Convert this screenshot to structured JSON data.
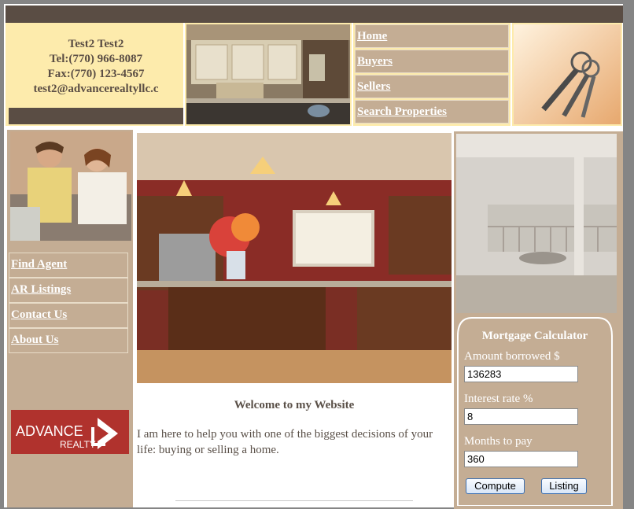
{
  "contact": {
    "name": "Test2  Test2",
    "tel": "Tel:(770) 966-8087",
    "fax": "Fax:(770) 123-4567",
    "email": "test2@advancerealtyllc.c"
  },
  "top_nav": [
    "Home",
    "Buyers",
    "Sellers",
    "Search Properties"
  ],
  "side_nav": [
    "Find Agent",
    "AR Listings",
    "Contact Us",
    "About Us"
  ],
  "logo": {
    "text_main": "ADVANCE",
    "text_sub": "REALTY"
  },
  "main": {
    "welcome": "Welcome to my Website",
    "intro": "I am here to help you with one of the biggest decisions of your life: buying or selling a home."
  },
  "calculator": {
    "title": "Mortgage Calculator",
    "amount_label": "Amount borrowed $",
    "amount_value": "136283",
    "rate_label": "Interest rate %",
    "rate_value": "8",
    "months_label": "Months to pay",
    "months_value": "360",
    "compute_label": "Compute",
    "listing_label": "Listing"
  },
  "colors": {
    "brown_dark": "#5a4d44",
    "tan": "#c4ad94",
    "cream": "#fdebac",
    "logo_red": "#b0322d"
  }
}
